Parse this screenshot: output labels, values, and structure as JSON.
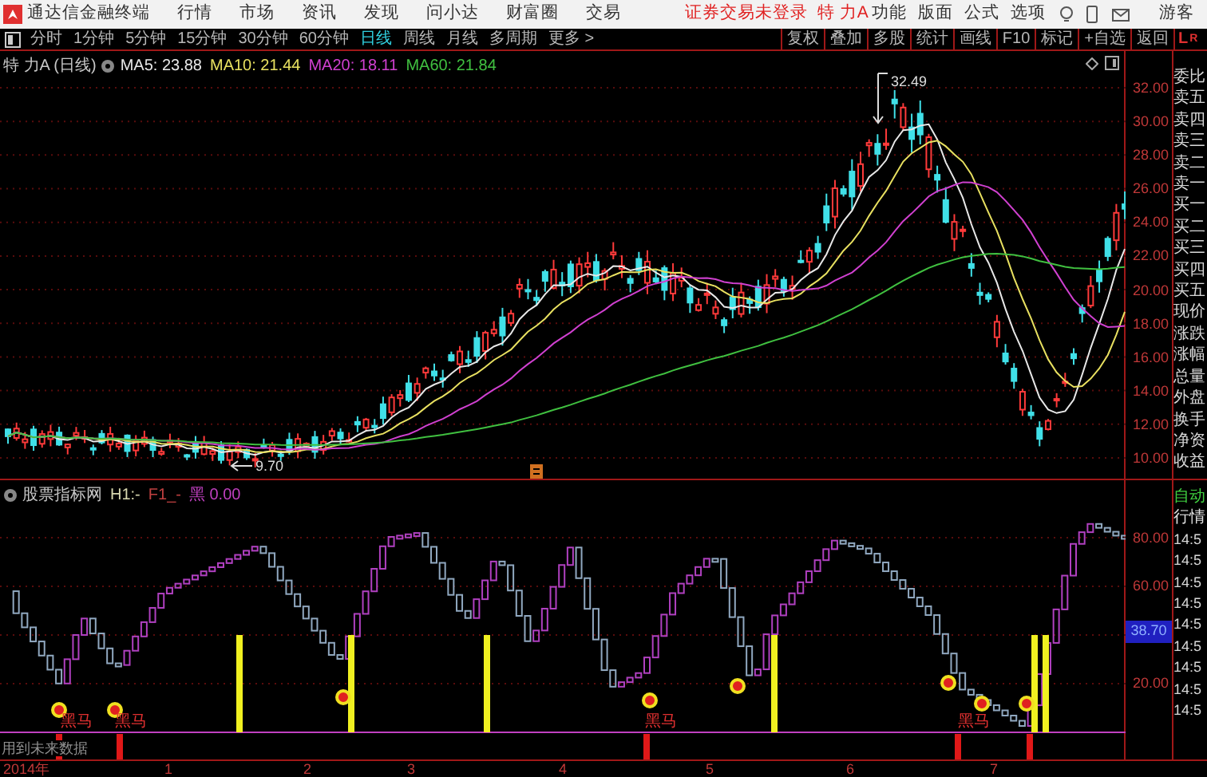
{
  "title_bar": {
    "app_name": "通达信金融终端",
    "menu": [
      "行情",
      "市场",
      "资讯",
      "发现",
      "问小达",
      "财富圈",
      "交易"
    ],
    "login_status": "证券交易未登录",
    "stock_name": "特 力A",
    "tools": [
      "功能",
      "版面",
      "公式",
      "选项"
    ],
    "user": "游客"
  },
  "period_tabs": [
    {
      "label": "分时",
      "selected": false
    },
    {
      "label": "1分钟",
      "selected": false
    },
    {
      "label": "5分钟",
      "selected": false
    },
    {
      "label": "15分钟",
      "selected": false
    },
    {
      "label": "30分钟",
      "selected": false
    },
    {
      "label": "60分钟",
      "selected": false
    },
    {
      "label": "日线",
      "selected": true
    },
    {
      "label": "周线",
      "selected": false
    },
    {
      "label": "月线",
      "selected": false
    },
    {
      "label": "多周期",
      "selected": false
    },
    {
      "label": "更多 >",
      "selected": false
    }
  ],
  "toolbar": [
    "复权",
    "叠加",
    "多股",
    "统计",
    "画线",
    "F10",
    "标记",
    "+自选",
    "返回"
  ],
  "corner_labels": [
    "L",
    "R"
  ],
  "main_chart": {
    "stock": "特 力A (日线)",
    "ma": [
      {
        "label": "MA5: 23.88",
        "color": "#e8e8e8"
      },
      {
        "label": "MA10: 21.44",
        "color": "#e8e060"
      },
      {
        "label": "MA20: 18.11",
        "color": "#d040d0"
      },
      {
        "label": "MA60: 21.84",
        "color": "#40c040"
      }
    ],
    "y_labels": [
      "32.00",
      "30.00",
      "28.00",
      "26.00",
      "24.00",
      "22.00",
      "20.00",
      "18.00",
      "16.00",
      "14.00",
      "12.00",
      "10.00"
    ],
    "high_marker": "32.49",
    "low_marker": "9.70"
  },
  "quote_labels": [
    "委比",
    "卖五",
    "卖四",
    "卖三",
    "卖二",
    "卖一",
    "买一",
    "买二",
    "买三",
    "买四",
    "买五",
    "现价",
    "涨跌",
    "涨幅",
    "总量",
    "外盘",
    "换手",
    "净资",
    "收益"
  ],
  "indicator": {
    "name": "股票指标网",
    "legend": [
      {
        "text": "H1:-",
        "color": "#d8d8b0"
      },
      {
        "text": "F1_-",
        "color": "#c04040"
      },
      {
        "text": "黑 0.00",
        "color": "#c040c0"
      }
    ],
    "y_labels": [
      "80.00",
      "60.00",
      "20.00"
    ],
    "current_value": "38.70",
    "signal_labels": [
      "黑马",
      "黑马",
      "黑马",
      "黑马"
    ],
    "note": "用到未来数据"
  },
  "detail_panel": {
    "tabs": [
      "自动",
      "行情"
    ],
    "times": [
      "14:5",
      "14:5",
      "14:5",
      "14:5",
      "14:5",
      "14:5",
      "14:5",
      "14:5",
      "14:5"
    ]
  },
  "x_axis": [
    "2014年",
    "1",
    "2",
    "3",
    "4",
    "5",
    "6",
    "7"
  ]
}
